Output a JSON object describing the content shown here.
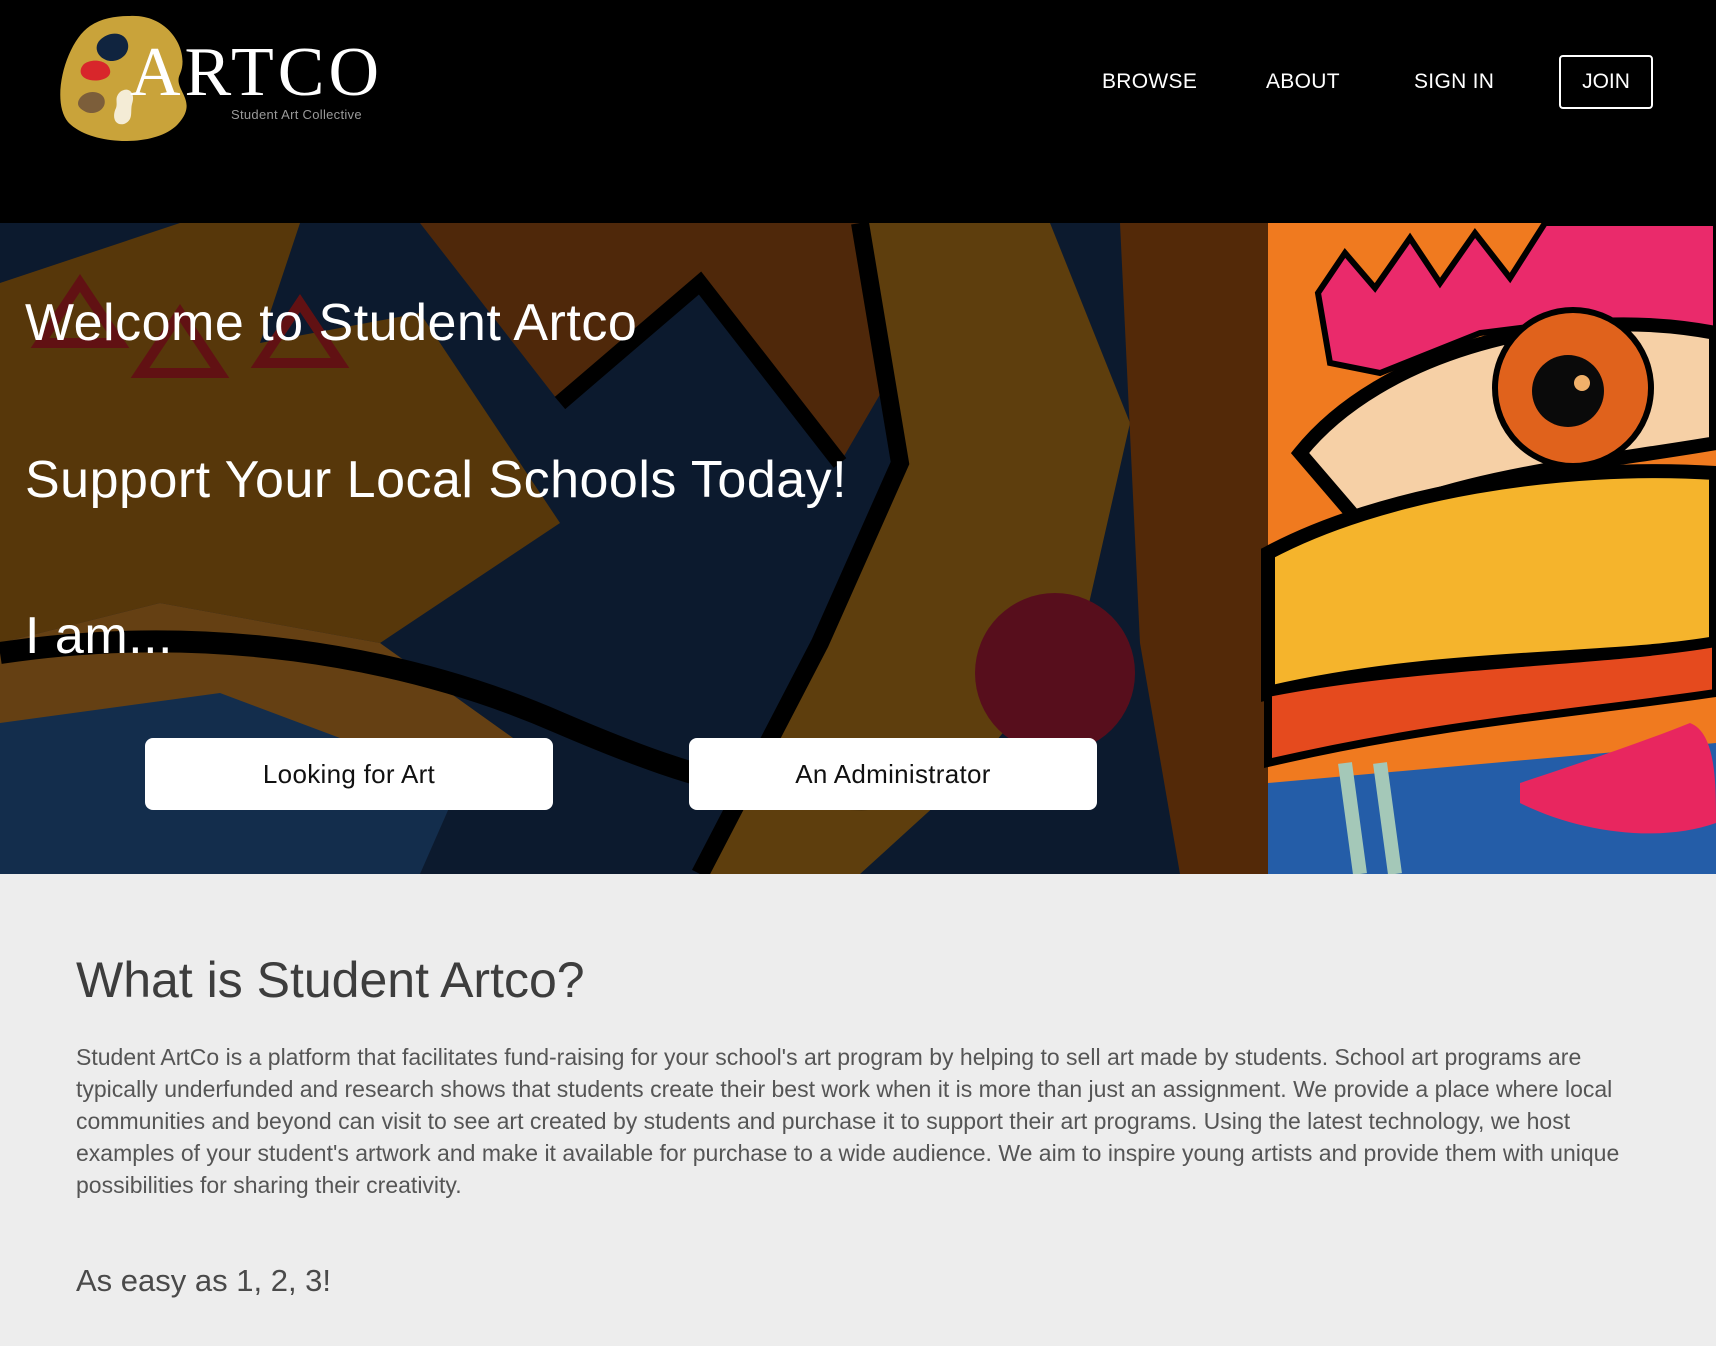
{
  "brand": {
    "wordmark": "ARTCO",
    "tagline": "Student Art Collective",
    "palette_color": "#c9a33a"
  },
  "nav": {
    "browse": "BROWSE",
    "about": "ABOUT",
    "sign_in": "SIGN IN",
    "join": "JOIN"
  },
  "hero": {
    "welcome": "Welcome to Student Artco",
    "support": "Support Your Local Schools Today!",
    "i_am": "I am...",
    "btn_looking": "Looking for Art",
    "btn_admin": "An Administrator"
  },
  "about": {
    "title": "What is Student Artco?",
    "body": "Student ArtCo is a platform that facilitates fund-raising for your school's art program by helping to sell art made by students. School art programs are typically underfunded and research shows that students create their best work when it is more than just an assignment. We provide a place where local communities and beyond can visit to see art created by students and purchase it to support their art programs. Using the latest technology, we host examples of your student's artwork and make it available for purchase to a wide audience. We aim to inspire young artists and provide them with unique possibilities for sharing their creativity.",
    "subheading": "As easy as 1, 2, 3!"
  },
  "colors": {
    "header_bg": "#000000",
    "page_bg": "#ededed",
    "text_dark": "#444444"
  }
}
